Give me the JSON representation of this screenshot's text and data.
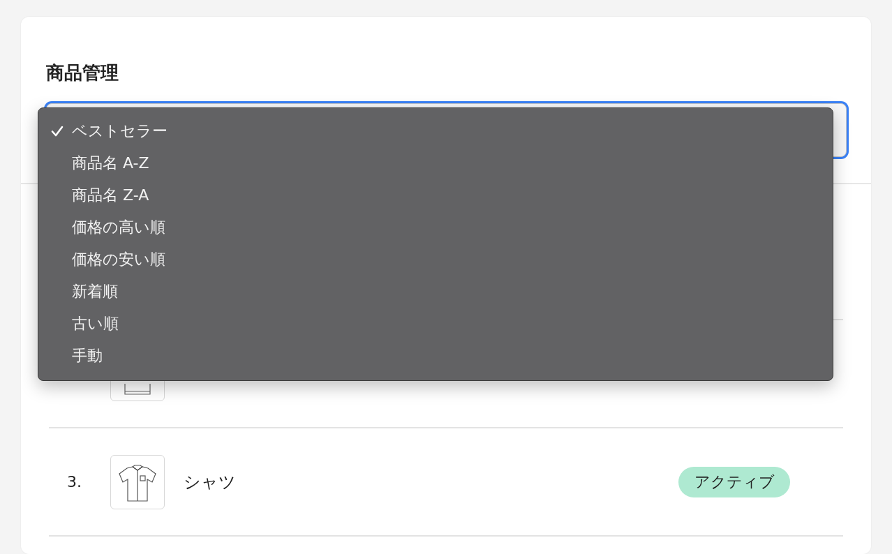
{
  "title": "商品管理",
  "sort_select": {
    "focused": true
  },
  "sort_menu": {
    "open": true,
    "options": [
      {
        "label": "ベストセラー",
        "selected": true
      },
      {
        "label": "商品名 A-Z",
        "selected": false
      },
      {
        "label": "商品名 Z-A",
        "selected": false
      },
      {
        "label": "価格の高い順",
        "selected": false
      },
      {
        "label": "価格の安い順",
        "selected": false
      },
      {
        "label": "新着順",
        "selected": false
      },
      {
        "label": "古い順",
        "selected": false
      },
      {
        "label": "手動",
        "selected": false
      }
    ]
  },
  "products": [
    {
      "kind": "hidden"
    },
    {
      "kind": "covered",
      "thumbnail": {
        "kind": "folded"
      }
    },
    {
      "kind": "full",
      "number": "3.",
      "thumbnail": {
        "kind": "shirt"
      },
      "name": "シャツ",
      "status": "アクティブ"
    }
  ]
}
